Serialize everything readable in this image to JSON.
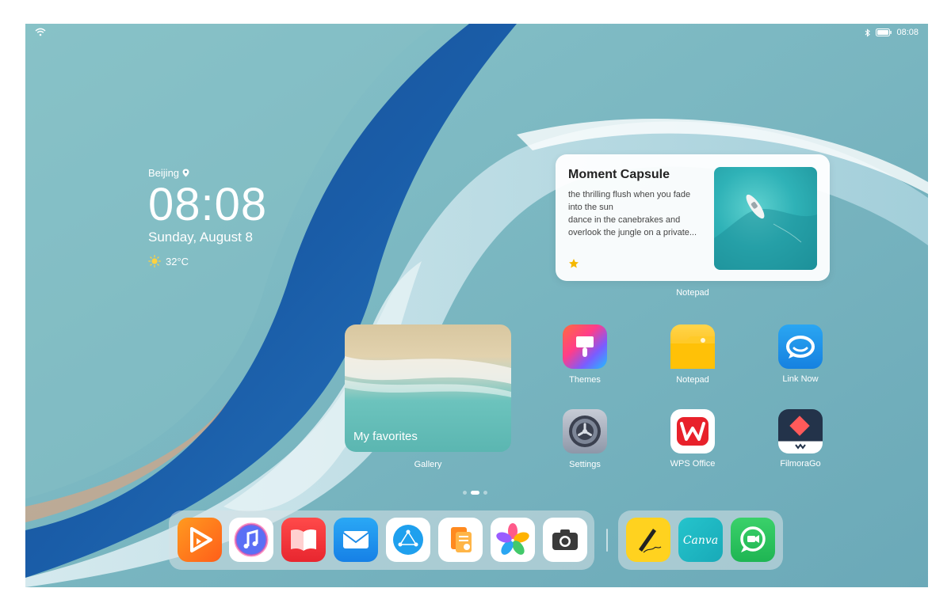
{
  "status_bar": {
    "time": "08:08",
    "icons": [
      "wifi-icon",
      "bluetooth-icon",
      "battery-icon"
    ]
  },
  "clock_widget": {
    "city": "Beijing",
    "time": "08:08",
    "date": "Sunday, August 8",
    "temperature": "32°C"
  },
  "moment_capsule": {
    "title": "Moment Capsule",
    "lines": [
      "the thrilling flush when you fade",
      "into the sun",
      "dance in the canebrakes and",
      "overlook the jungle on a private..."
    ],
    "app_label": "Notepad"
  },
  "gallery_widget": {
    "caption": "My favorites",
    "app_label": "Gallery"
  },
  "apps": [
    {
      "label": "Themes",
      "icon": "themes-brush-icon"
    },
    {
      "label": "Notepad",
      "icon": "notepad-folder-icon"
    },
    {
      "label": "Link Now",
      "icon": "link-now-chat-icon"
    },
    {
      "label": "Settings",
      "icon": "settings-gear-icon"
    },
    {
      "label": "WPS Office",
      "icon": "wps-office-icon"
    },
    {
      "label": "FilmoraGo",
      "icon": "filmorago-icon"
    }
  ],
  "dock_apps": [
    "video-play-icon",
    "music-note-icon",
    "books-icon",
    "mail-icon",
    "browser-globe-icon",
    "docs-icon",
    "gallery-petals-icon",
    "camera-icon"
  ],
  "dock_recent_apps": [
    {
      "icon": "sign-pen-icon"
    },
    {
      "icon": "canva-icon",
      "text": "Canva"
    },
    {
      "icon": "video-chat-icon"
    }
  ],
  "colors": {
    "accent": "#1f9de4",
    "wallpaper": "#5e9fb1"
  },
  "page_indicator": {
    "count": 3,
    "active": 2
  }
}
